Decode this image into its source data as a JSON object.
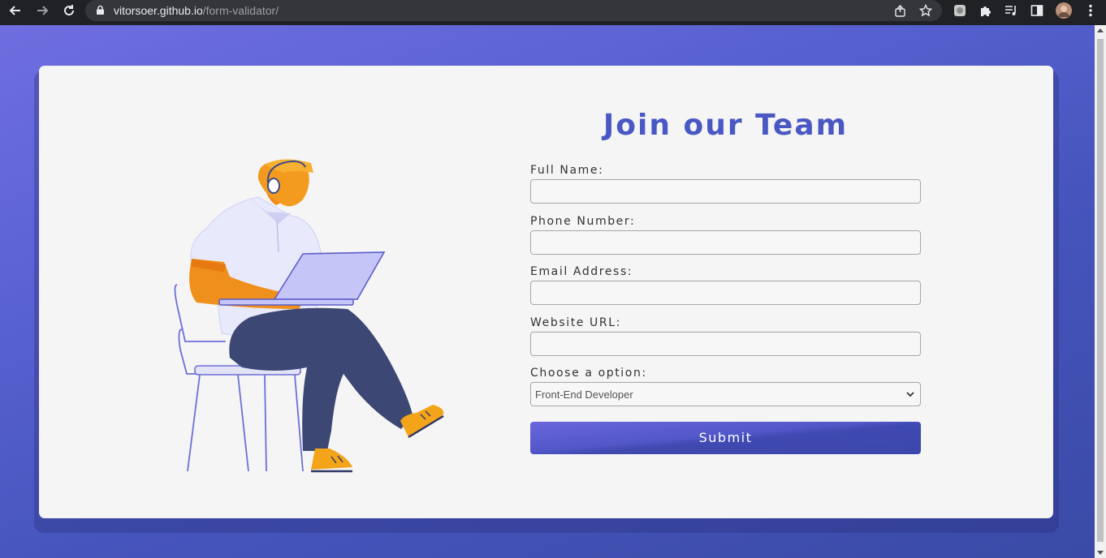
{
  "browser": {
    "url_host": "vitorsoer.github.io",
    "url_path": "/form-validator/",
    "icons": [
      "back-arrow-icon",
      "forward-arrow-icon",
      "reload-icon",
      "lock-icon",
      "share-icon",
      "star-icon",
      "extension-icon",
      "puzzle-icon",
      "media-icon",
      "sidepanel-icon",
      "avatar",
      "kebab-menu-icon"
    ]
  },
  "form": {
    "title": "Join our Team",
    "fields": [
      {
        "label": "Full Name:",
        "value": ""
      },
      {
        "label": "Phone Number:",
        "value": ""
      },
      {
        "label": "Email Address:",
        "value": ""
      },
      {
        "label": "Website URL:",
        "value": ""
      }
    ],
    "select": {
      "label": "Choose a option:",
      "selected": "Front-End Developer"
    },
    "submit_label": "Submit"
  },
  "colors": {
    "accent": "#4a58c4",
    "background_gradient_start": "#6f6ee0",
    "background_gradient_end": "#3a4aa6",
    "card": "#f5f5f5"
  }
}
